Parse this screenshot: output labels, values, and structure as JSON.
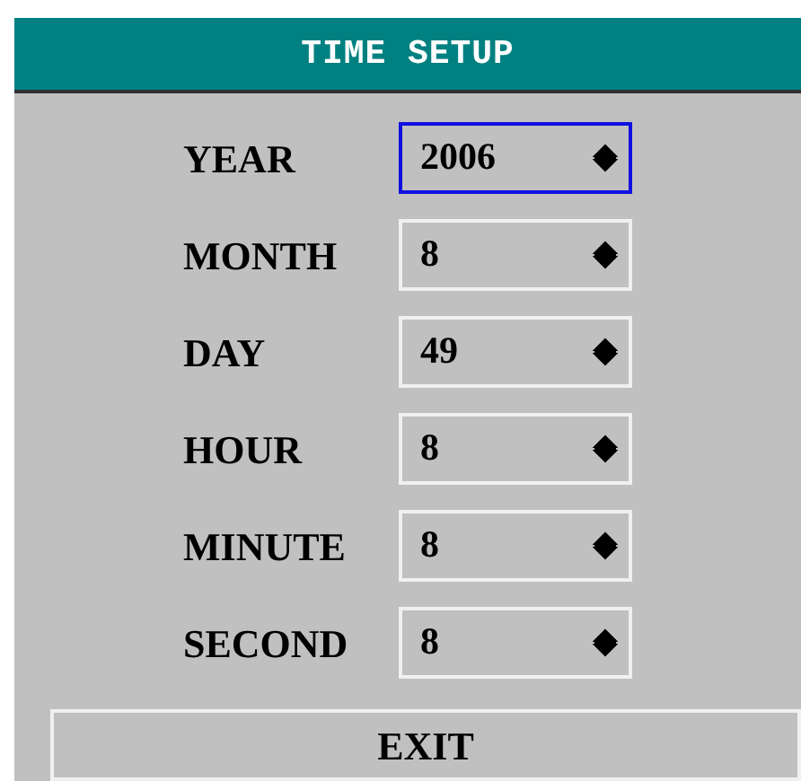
{
  "title": "TIME SETUP",
  "fields": [
    {
      "label": "YEAR",
      "value": "2006",
      "selected": true
    },
    {
      "label": "MONTH",
      "value": "8",
      "selected": false
    },
    {
      "label": "DAY",
      "value": "49",
      "selected": false
    },
    {
      "label": "HOUR",
      "value": "8",
      "selected": false
    },
    {
      "label": "MINUTE",
      "value": "8",
      "selected": false
    },
    {
      "label": "SECOND",
      "value": "8",
      "selected": false
    }
  ],
  "exit_button": "EXIT"
}
